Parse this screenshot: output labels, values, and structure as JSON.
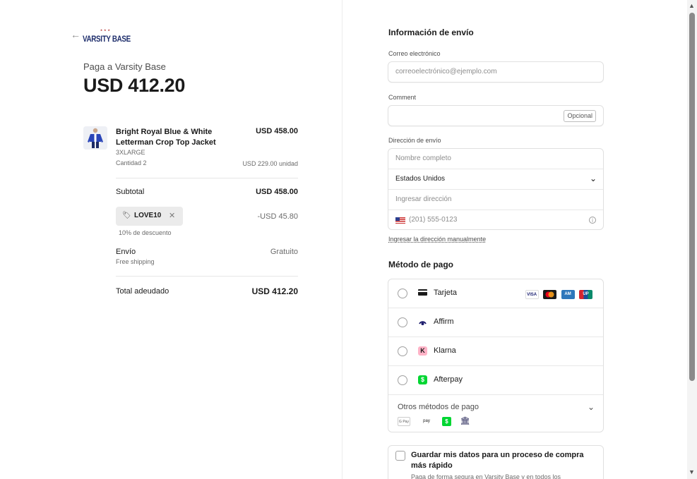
{
  "merchant": {
    "back_icon": "arrow-left-icon",
    "logo_top": "VARSITY BASE",
    "logo_text": "VARSITY BASE",
    "pay_to": "Paga a Varsity Base",
    "total_amount": "USD 412.20"
  },
  "cart": {
    "item": {
      "name": "Bright Royal Blue & White Letterman Crop Top Jacket",
      "price": "USD 458.00",
      "size": "3XLARGE",
      "quantity": "Cantidad 2",
      "unit_price": "USD 229.00 unidad"
    },
    "subtotal_label": "Subtotal",
    "subtotal_value": "USD 458.00",
    "discount": {
      "code": "LOVE10",
      "amount": "-USD 45.80",
      "note": "10% de descuento",
      "tag_icon": "tag-icon",
      "remove_icon": "close-icon"
    },
    "shipping_label": "Envío",
    "shipping_sub": "Free shipping",
    "shipping_value": "Gratuito",
    "total_label": "Total adeudado",
    "total_value": "USD 412.20"
  },
  "shipping_info": {
    "title": "Información de envío",
    "email_label": "Correo electrónico",
    "email_placeholder": "correoelectrónico@ejemplo.com",
    "comment_label": "Comment",
    "comment_optional": "Opcional",
    "address_label": "Dirección de envío",
    "name_placeholder": "Nombre completo",
    "country_value": "Estados Unidos",
    "address_placeholder": "Ingresar dirección",
    "phone_placeholder": "(201) 555-0123",
    "manual_link": "Ingresar la dirección manualmente"
  },
  "payment": {
    "title": "Método de pago",
    "methods": [
      {
        "label": "Tarjeta",
        "icon": "card-icon"
      },
      {
        "label": "Affirm",
        "icon": "affirm-icon"
      },
      {
        "label": "Klarna",
        "icon": "klarna-icon"
      },
      {
        "label": "Afterpay",
        "icon": "afterpay-icon"
      }
    ],
    "card_brands": [
      "VISA",
      "Mastercard",
      "American Express",
      "UnionPay"
    ],
    "other_label": "Otros métodos de pago",
    "other_icons": [
      "google-pay-icon",
      "amazon-pay-icon",
      "cash-app-icon",
      "bank-icon"
    ],
    "klarna_color": "#ffb3c7",
    "afterpay_color": "#00d632"
  },
  "save": {
    "title": "Guardar mis datos para un proceso de compra más rápido",
    "subtitle": "Paga de forma segura en Varsity Base y en todos los"
  }
}
